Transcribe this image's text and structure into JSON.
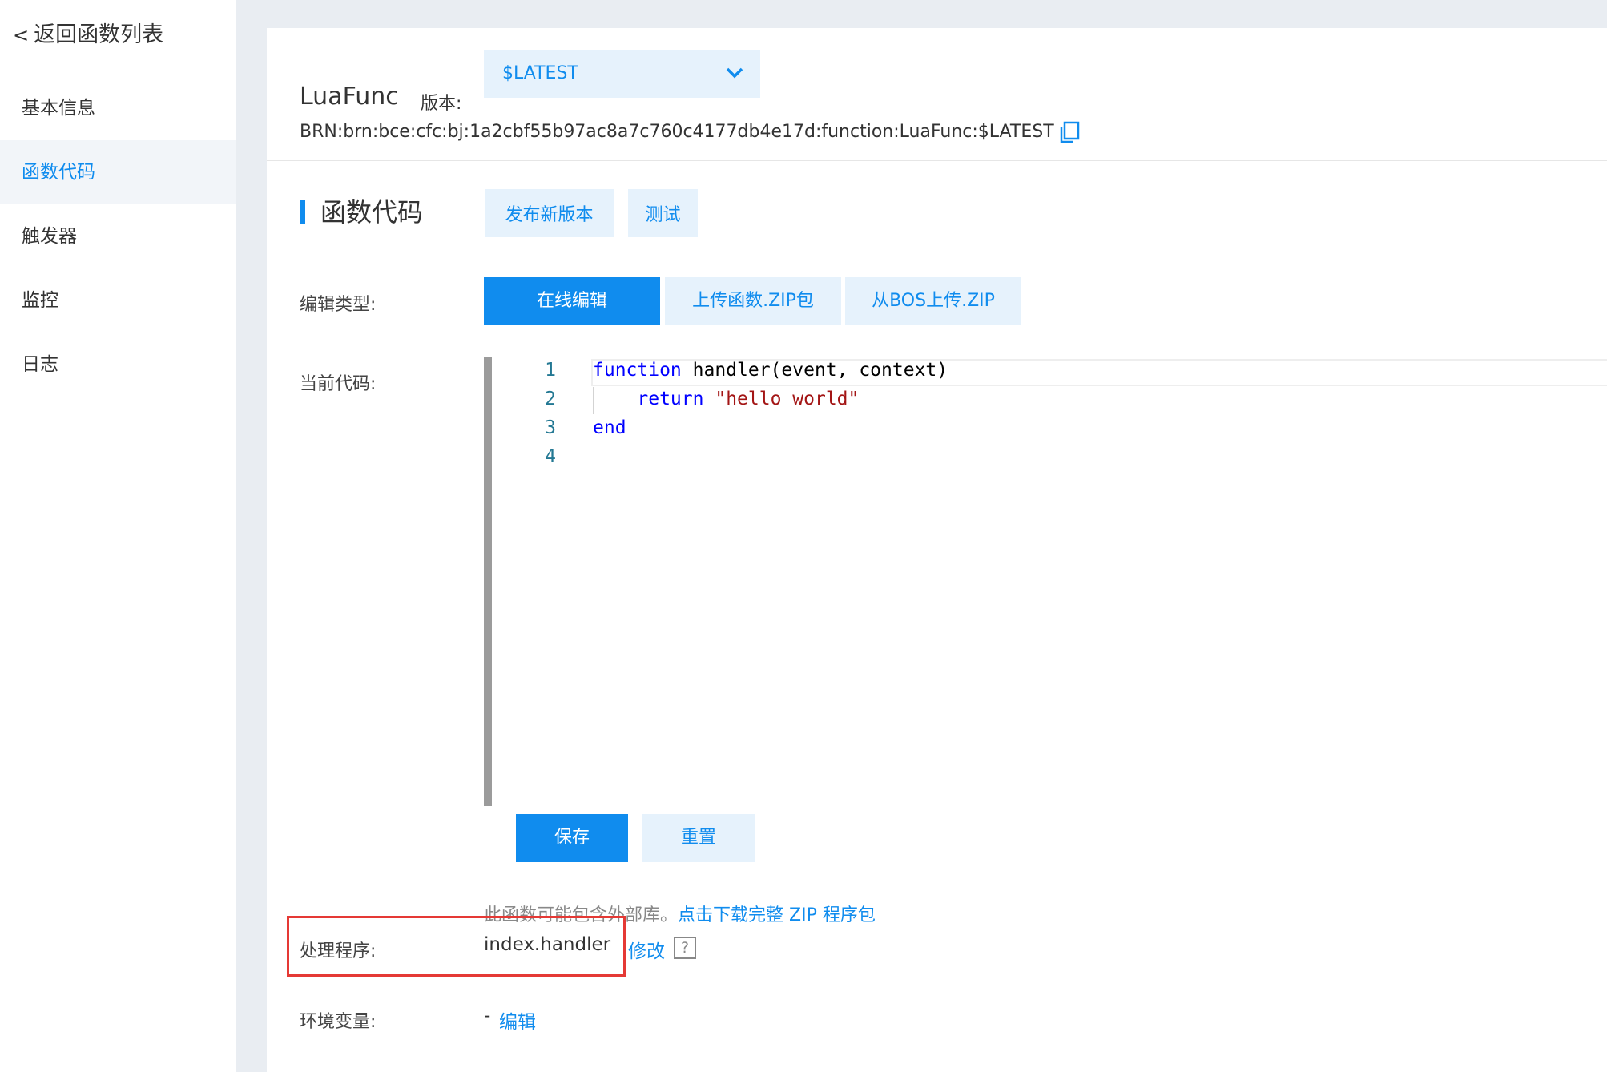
{
  "sidebar": {
    "back_label": "返回函数列表",
    "items": [
      {
        "label": "基本信息",
        "active": false
      },
      {
        "label": "函数代码",
        "active": true
      },
      {
        "label": "触发器",
        "active": false
      },
      {
        "label": "监控",
        "active": false
      },
      {
        "label": "日志",
        "active": false
      }
    ]
  },
  "header": {
    "function_name": "LuaFunc",
    "version_label": "版本:",
    "version_value": "$LATEST",
    "brn_label": "BRN:",
    "brn_value": "brn:bce:cfc:bj:1a2cbf55b97ac8a7c760c4177db4e17d:function:LuaFunc:$LATEST"
  },
  "section": {
    "title": "函数代码",
    "publish_button": "发布新版本",
    "test_button": "测试"
  },
  "edit_type": {
    "label": "编辑类型:",
    "tabs": [
      "在线编辑",
      "上传函数.ZIP包",
      "从BOS上传.ZIP"
    ],
    "active_tab": 0
  },
  "code": {
    "label": "当前代码:",
    "line_numbers": [
      "1",
      "2",
      "3",
      "4"
    ],
    "lines": {
      "l1_kw": "function",
      "l1_rest": " handler(event, context)",
      "l2_indent": "    ",
      "l2_kw": "return",
      "l2_str": "\"hello world\"",
      "l3_kw": "end"
    },
    "save_button": "保存",
    "reset_button": "重置"
  },
  "hint": {
    "text": "此函数可能包含外部库。",
    "link": "点击下载完整 ZIP 程序包"
  },
  "handler": {
    "label": "处理程序:",
    "value": "index.handler",
    "edit_link": "修改",
    "help": "?"
  },
  "env": {
    "label": "环境变量:",
    "dash": "-",
    "edit_link": "编辑"
  },
  "colors": {
    "accent": "#108cee",
    "accent_light": "#e6f2fc",
    "highlight_border": "#e53935",
    "background": "#e9edf2"
  }
}
